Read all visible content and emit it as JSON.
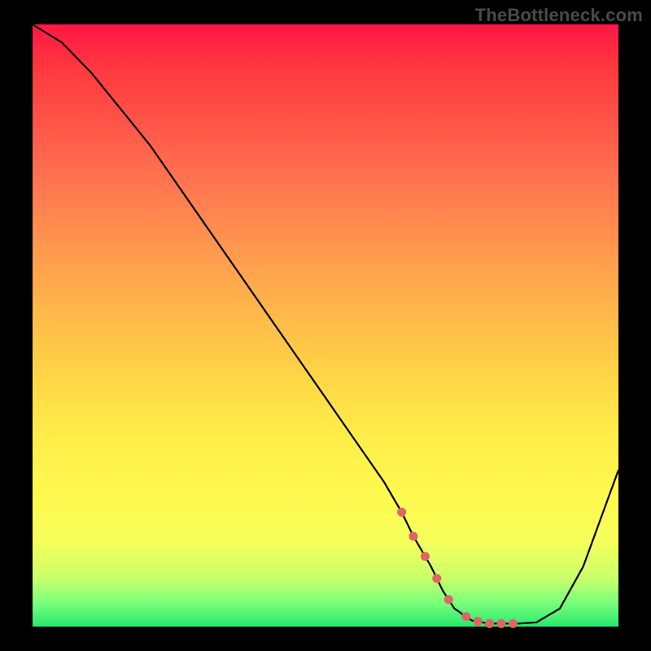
{
  "watermark": "TheBottleneck.com",
  "colors": {
    "frame": "#000000",
    "curve": "#000000",
    "dot": "#e06666"
  },
  "chart_data": {
    "type": "line",
    "title": "",
    "xlabel": "",
    "ylabel": "",
    "xlim": [
      0,
      100
    ],
    "ylim": [
      0,
      100
    ],
    "grid": false,
    "x": [
      0,
      5,
      10,
      15,
      20,
      25,
      30,
      35,
      40,
      45,
      50,
      55,
      60,
      63,
      65,
      68,
      70,
      72,
      75,
      78,
      80,
      83,
      86,
      90,
      94,
      100
    ],
    "values": [
      100,
      97,
      92,
      86,
      80,
      73,
      66,
      59,
      52,
      45,
      38,
      31,
      24,
      19,
      15,
      10,
      6,
      3,
      1,
      0.5,
      0.5,
      0.5,
      0.7,
      3,
      10,
      26
    ],
    "optimal_range_x": [
      63,
      83
    ],
    "optimal_dot_x": [
      63,
      65,
      67,
      69,
      71,
      74,
      76,
      78,
      80,
      82
    ]
  }
}
